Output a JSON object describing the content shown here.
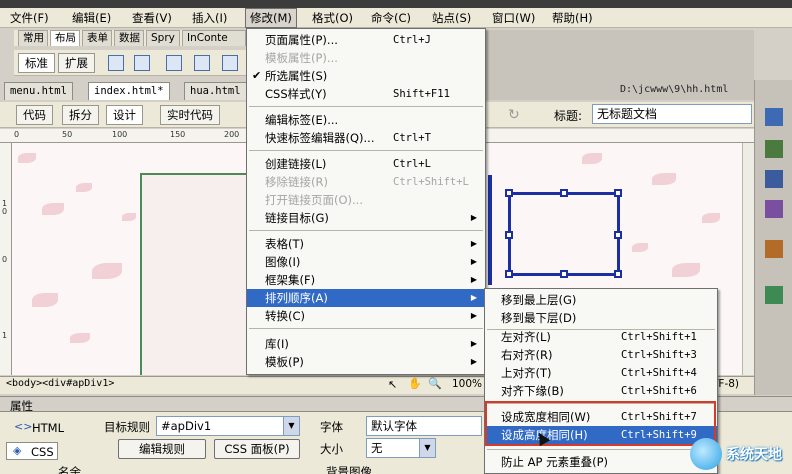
{
  "menubar": {
    "items": [
      {
        "label": "文件(F)"
      },
      {
        "label": "编辑(E)"
      },
      {
        "label": "查看(V)"
      },
      {
        "label": "插入(I)"
      },
      {
        "label": "修改(M)"
      },
      {
        "label": "格式(O)"
      },
      {
        "label": "命令(C)"
      },
      {
        "label": "站点(S)"
      },
      {
        "label": "窗口(W)"
      },
      {
        "label": "帮助(H)"
      }
    ]
  },
  "insert_panel": {
    "tabs": [
      "常用",
      "布局",
      "表单",
      "数据",
      "Spry",
      "InConte"
    ],
    "buttons": {
      "standard": "标准",
      "expanded": "扩展"
    }
  },
  "doc_tabs": [
    "menu.html",
    "index.html*",
    "hua.html"
  ],
  "path": "D:\\jcwww\\9\\hh.html",
  "doc_toolbar": {
    "code": "代码",
    "split": "拆分",
    "design": "设计",
    "live_code": "实时代码",
    "title_label": "标题:",
    "title_value": "无标题文档"
  },
  "ruler": {
    "ticks": [
      "0",
      "50",
      "100",
      "150",
      "200"
    ]
  },
  "ruler_left": [
    "1",
    "0",
    "0",
    "1"
  ],
  "status_bar": {
    "tag_path": "<body><div#apDiv1>",
    "zoom": "100%",
    "encoding": "TF-8)"
  },
  "properties": {
    "header": "属性",
    "html_label": "HTML",
    "css_label": "CSS",
    "target_rule_label": "目标规则",
    "target_rule_value": "#apDiv1",
    "font_label": "字体",
    "font_value": "默认字体",
    "size_label": "大小",
    "size_value": "无",
    "edit_rule": "编辑规则",
    "css_panel": "CSS 面板(P)",
    "bottom_a": "名余",
    "bottom_b": "背景图像"
  },
  "modify_menu": {
    "items": [
      {
        "label": "页面属性(P)...",
        "shortcut": "Ctrl+J",
        "disabled": false
      },
      {
        "label": "模板属性(P)...",
        "shortcut": "",
        "disabled": true
      },
      {
        "label": "所选属性(S)",
        "shortcut": "",
        "disabled": false,
        "checked": true
      },
      {
        "label": "CSS样式(Y)",
        "shortcut": "Shift+F11",
        "disabled": false
      },
      {
        "sep": true
      },
      {
        "label": "编辑标签(E)...",
        "shortcut": "",
        "disabled": false
      },
      {
        "label": "快速标签编辑器(Q)...",
        "shortcut": "Ctrl+T",
        "disabled": false
      },
      {
        "sep": true
      },
      {
        "label": "创建链接(L)",
        "shortcut": "Ctrl+L",
        "disabled": false
      },
      {
        "label": "移除链接(R)",
        "shortcut": "Ctrl+Shift+L",
        "disabled": true
      },
      {
        "label": "打开链接页面(O)...",
        "shortcut": "",
        "disabled": true
      },
      {
        "label": "链接目标(G)",
        "shortcut": "",
        "disabled": false,
        "submenu": true
      },
      {
        "sep": true
      },
      {
        "label": "表格(T)",
        "shortcut": "",
        "disabled": false,
        "submenu": true
      },
      {
        "label": "图像(I)",
        "shortcut": "",
        "disabled": false,
        "submenu": true
      },
      {
        "label": "框架集(F)",
        "shortcut": "",
        "disabled": false,
        "submenu": true
      },
      {
        "label": "排列顺序(A)",
        "shortcut": "",
        "disabled": false,
        "submenu": true,
        "highlighted": true
      },
      {
        "label": "转换(C)",
        "shortcut": "",
        "disabled": false,
        "submenu": true
      },
      {
        "sep": true
      },
      {
        "label": "库(I)",
        "shortcut": "",
        "disabled": false,
        "submenu": true
      },
      {
        "label": "模板(P)",
        "shortcut": "",
        "disabled": false,
        "submenu": true
      }
    ]
  },
  "arrange_menu": {
    "items": [
      {
        "label": "移到最上层(G)",
        "shortcut": ""
      },
      {
        "label": "移到最下层(D)",
        "shortcut": ""
      },
      {
        "sep": true
      },
      {
        "label": "左对齐(L)",
        "shortcut": "Ctrl+Shift+1"
      },
      {
        "label": "右对齐(R)",
        "shortcut": "Ctrl+Shift+3"
      },
      {
        "label": "上对齐(T)",
        "shortcut": "Ctrl+Shift+4"
      },
      {
        "label": "对齐下缘(B)",
        "shortcut": "Ctrl+Shift+6"
      },
      {
        "sep": true
      },
      {
        "label": "设成宽度相同(W)",
        "shortcut": "Ctrl+Shift+7"
      },
      {
        "label": "设成高度相同(H)",
        "shortcut": "Ctrl+Shift+9",
        "highlighted": true
      },
      {
        "sep": true
      },
      {
        "label": "防止 AP 元素重叠(P)",
        "shortcut": ""
      }
    ]
  },
  "watermark": "系统天地"
}
